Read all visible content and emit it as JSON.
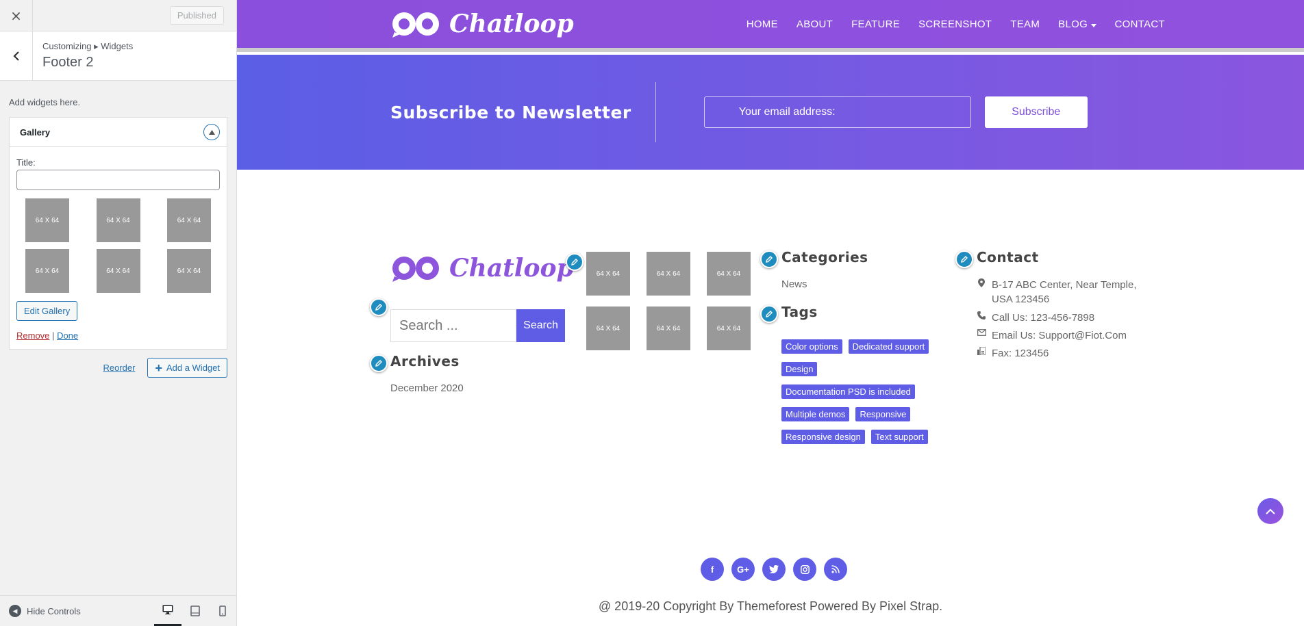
{
  "customizer": {
    "close_label": "×",
    "published_label": "Published",
    "breadcrumb": "Customizing ▸ Widgets",
    "section_title": "Footer 2",
    "description": "Add widgets here.",
    "widget": {
      "title": "Gallery",
      "field_label": "Title:",
      "field_value": "",
      "thumbs": [
        "64 X 64",
        "64 X 64",
        "64 X 64",
        "64 X 64",
        "64 X 64",
        "64 X 64"
      ],
      "edit_button": "Edit Gallery",
      "remove_link": "Remove",
      "separator": "|",
      "done_link": "Done"
    },
    "reorder_link": "Reorder",
    "add_widget_button": "Add a Widget",
    "hide_controls": "Hide Controls",
    "devices": [
      "desktop-icon",
      "tablet-icon",
      "mobile-icon"
    ]
  },
  "site": {
    "brand": "Chatloop",
    "nav": [
      "HOME",
      "ABOUT",
      "FEATURE",
      "SCREENSHOT",
      "TEAM",
      "BLOG",
      "CONTACT"
    ],
    "newsletter": {
      "title": "Subscribe to Newsletter",
      "placeholder": "Your email address:",
      "button": "Subscribe"
    },
    "footer": {
      "search_placeholder": "Search ...",
      "search_button": "Search",
      "archives_heading": "Archives",
      "archives": [
        "December 2020"
      ],
      "gallery_thumbs": [
        "64 X 64",
        "64 X 64",
        "64 X 64",
        "64 X 64",
        "64 X 64",
        "64 X 64"
      ],
      "categories_heading": "Categories",
      "categories": [
        "News"
      ],
      "tags_heading": "Tags",
      "tags": [
        "Color options",
        "Dedicated support",
        "Design",
        "Documentation PSD is included",
        "Multiple demos",
        "Responsive",
        "Responsive design",
        "Text support"
      ],
      "contact_heading": "Contact",
      "contact": {
        "address_1": "B-17 ABC Center, Near Temple,",
        "address_2": "USA 123456",
        "phone": "Call Us: 123-456-7898",
        "email": "Email Us: Support@Fiot.Com",
        "fax": "Fax: 123456"
      },
      "socials": [
        "f",
        "G+",
        "t",
        "ig",
        "rss"
      ],
      "copyright": "@ 2019-20 Copyright By Themeforest Powered By Pixel Strap."
    }
  },
  "colors": {
    "nav_purple": "#8a4fdc",
    "accent": "#5f5de6",
    "wp_blue": "#2271b1",
    "pencil_blue": "#1e8cbe"
  }
}
